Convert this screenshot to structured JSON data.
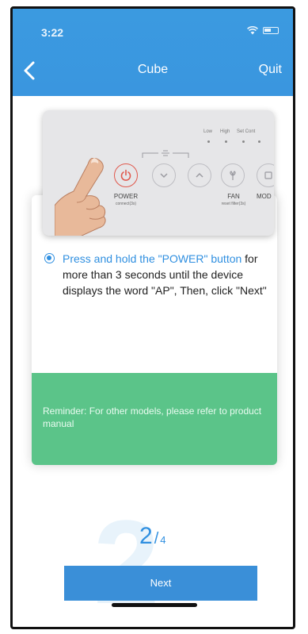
{
  "status_bar": {
    "time": "3:22"
  },
  "nav": {
    "title": "Cube",
    "quit": "Quit"
  },
  "device_panel": {
    "top_labels": [
      "Low",
      "High",
      "Set Cont"
    ],
    "power_label": "POWER",
    "power_sub": "connect(3s)",
    "fan_label": "FAN",
    "fan_sub": "reset filter(3s)",
    "mode_label": "MOD"
  },
  "instruction": {
    "highlight": "Press and hold the \"POWER\" button",
    "rest": "for more than 3 seconds until the device displays the word \"AP\", Then, click \"Next\""
  },
  "reminder": "Reminder: For other models, please refer to product manual",
  "step": {
    "current": "2",
    "separator": "/",
    "total": "4"
  },
  "next_button": "Next",
  "colors": {
    "header": "#3a96df",
    "reminder": "#5bc489",
    "accent": "#2f8fe0",
    "button": "#3a8fd8"
  }
}
